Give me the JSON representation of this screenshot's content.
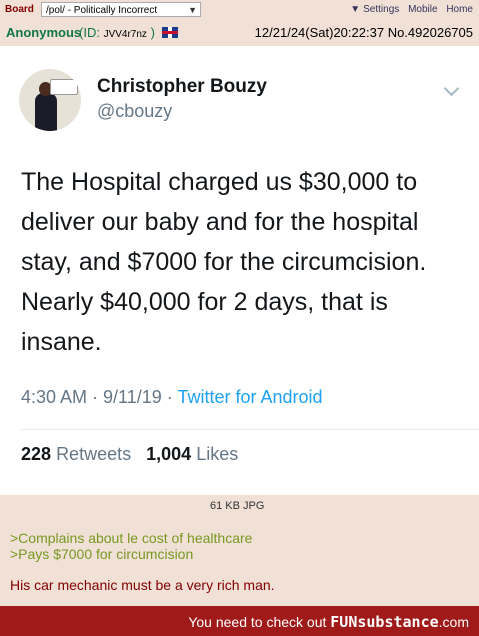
{
  "topbar": {
    "board_label": "Board",
    "board_select": "/pol/ - Politically Incorrect",
    "links": [
      "Settings",
      "Mobile",
      "Home"
    ]
  },
  "post": {
    "name": "Anonymous",
    "id_label": "(ID:",
    "id_value": "JVV4r7nz",
    "id_close": ")",
    "datetime": "12/21/24(Sat)20:22:37",
    "number": "No.492026705",
    "file_info": "61 KB JPG",
    "greentext": [
      ">Complains about le cost of healthcare",
      ">Pays $7000 for circumcision"
    ],
    "reply": "His car mechanic must be a very rich man."
  },
  "tweet": {
    "display_name": "Christopher Bouzy",
    "handle": "@cbouzy",
    "text": "The Hospital charged us $30,000 to deliver our baby and for the hospital stay, and $7000 for the circumcision. Nearly $40,000 for 2 days, that is insane.",
    "time": "4:30 AM · 9/11/19 ·",
    "client": "Twitter for Android",
    "retweets_count": "228",
    "retweets_label": "Retweets",
    "likes_count": "1,004",
    "likes_label": "Likes"
  },
  "footer": {
    "prefix": "You need to check out ",
    "brand": "FUNsubstance",
    "suffix": ".com"
  },
  "colors": {
    "post_bg": "#f0e0d6",
    "name_green": "#117743",
    "greentext": "#789922",
    "footer_red": "#a11a1a",
    "twitter_blue": "#1da1f2"
  }
}
